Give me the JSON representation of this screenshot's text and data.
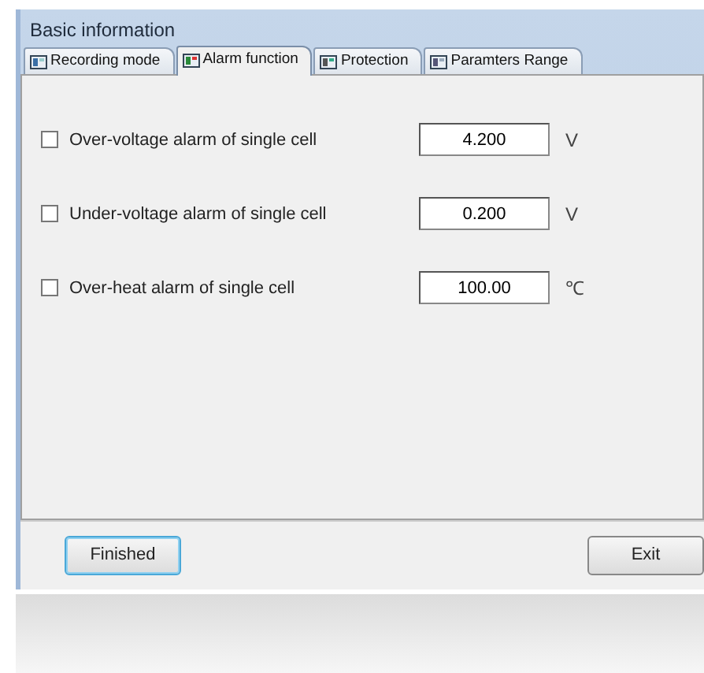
{
  "window": {
    "title": "Basic information"
  },
  "tabs": [
    {
      "label": "Recording mode",
      "selected": false
    },
    {
      "label": "Alarm function",
      "selected": true
    },
    {
      "label": "Protection",
      "selected": false
    },
    {
      "label": "Paramters Range",
      "selected": false
    }
  ],
  "alarms": [
    {
      "label": "Over-voltage alarm of single cell",
      "checked": false,
      "value": "4.200",
      "unit": "V"
    },
    {
      "label": "Under-voltage alarm of single cell",
      "checked": false,
      "value": "0.200",
      "unit": "V"
    },
    {
      "label": "Over-heat alarm of single cell",
      "checked": false,
      "value": "100.00",
      "unit": "℃"
    }
  ],
  "buttons": [
    {
      "label": "Finished",
      "focused": true
    },
    {
      "label": "Exit",
      "focused": false
    }
  ]
}
